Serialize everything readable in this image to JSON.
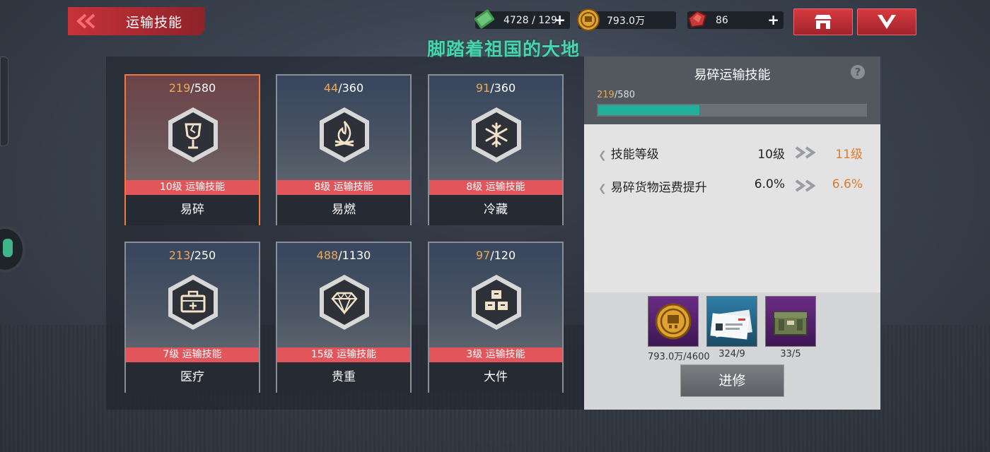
{
  "header": {
    "back_title": "运输技能",
    "resources": [
      {
        "name": "cash-bundle",
        "text": "4728 / 129",
        "has_plus": true
      },
      {
        "name": "gold-coin",
        "text": "793.0万",
        "has_plus": false
      },
      {
        "name": "ruby",
        "text": "86",
        "has_plus": true
      }
    ]
  },
  "overlay_title": "脚踏着祖国的大地",
  "skills": [
    {
      "current": "219",
      "max": "/580",
      "level": "10级 运输技能",
      "name": "易碎",
      "icon": "broken-glass-icon",
      "active": true
    },
    {
      "current": "44",
      "max": "/360",
      "level": "8级 运输技能",
      "name": "易燃",
      "icon": "flame-icon",
      "active": false
    },
    {
      "current": "91",
      "max": "/360",
      "level": "8级 运输技能",
      "name": "冷藏",
      "icon": "snowflake-icon",
      "active": false
    },
    {
      "current": "213",
      "max": "/250",
      "level": "7级 运输技能",
      "name": "医疗",
      "icon": "medkit-icon",
      "active": false
    },
    {
      "current": "488",
      "max": "/1130",
      "level": "15级 运输技能",
      "name": "贵重",
      "icon": "diamond-icon",
      "active": false
    },
    {
      "current": "97",
      "max": "/120",
      "level": "3级 运输技能",
      "name": "大件",
      "icon": "boxes-icon",
      "active": false
    }
  ],
  "detail": {
    "title": "易碎运输技能",
    "help": "?",
    "progress_current": "219",
    "progress_max": "/580",
    "progress_fraction": 0.3776,
    "stats": [
      {
        "label": "技能等级",
        "from": "10级",
        "to": "11级"
      },
      {
        "label": "易碎货物运费提升",
        "from": "6.0%",
        "to": "6.6%"
      }
    ],
    "materials": [
      {
        "icon": "gold-coin-icon",
        "count": "793.0万/4600"
      },
      {
        "icon": "license-card-icon",
        "count": "324/9"
      },
      {
        "icon": "crate-icon",
        "count": "33/5"
      }
    ],
    "upgrade_label": "进修"
  },
  "colors": {
    "accent_red": "#e2555b",
    "progress_teal": "#21b09c",
    "highlight_orange": "#f07a3c",
    "overlay_green": "#49d4b0"
  }
}
